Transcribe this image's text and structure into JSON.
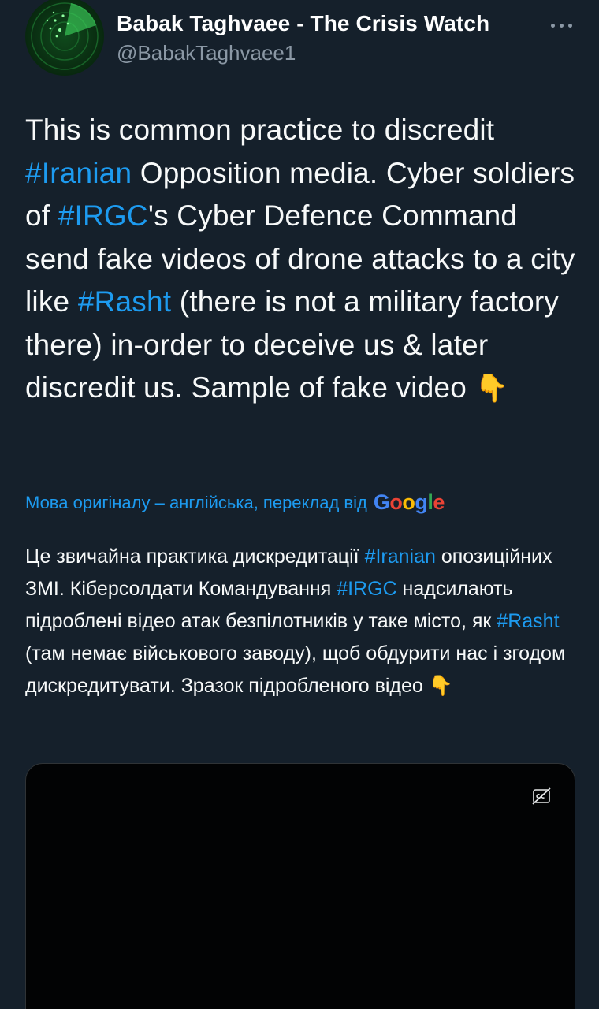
{
  "author": {
    "display_name": "Babak Taghvaee - The Crisis Watch",
    "handle": "@BabakTaghvaee1",
    "avatar_icon": "radar-avatar-icon"
  },
  "more_icon": "more-horizontal-icon",
  "tweet": {
    "s1": "This is common practice to discredit ",
    "tag_iranian": "#Iranian",
    "s2": " Opposition media. Cyber soldiers of ",
    "tag_irgc": "#IRGC",
    "s3": "'s Cyber Defence Command send fake videos of drone attacks to a city like ",
    "tag_rasht": "#Rasht",
    "s4": " (there is not a military factory there) in-order to deceive us & later discredit us. Sample of fake video ",
    "emoji": "👇"
  },
  "translation": {
    "notice": "Мова оригіналу – англійська, переклад від",
    "provider": "Google",
    "s1": "Це звичайна практика дискредитації ",
    "tag_iranian": "#Iranian",
    "s2": " опозиційних ЗМІ. Кіберсолдати Командування ",
    "tag_irgc": "#IRGC",
    "s3": " надсилають підроблені відео атак безпілотників у таке місто, як ",
    "tag_rasht": "#Rasht",
    "s4": " (там немає військового заводу), щоб обдурити нас і згодом дискредитувати. Зразок підробленого відео ",
    "emoji": "👇"
  },
  "video": {
    "captions_icon": "closed-captions-off-icon"
  },
  "colors": {
    "background": "#15202b",
    "accent": "#1d9bf0",
    "secondary_text": "#8b98a5"
  }
}
